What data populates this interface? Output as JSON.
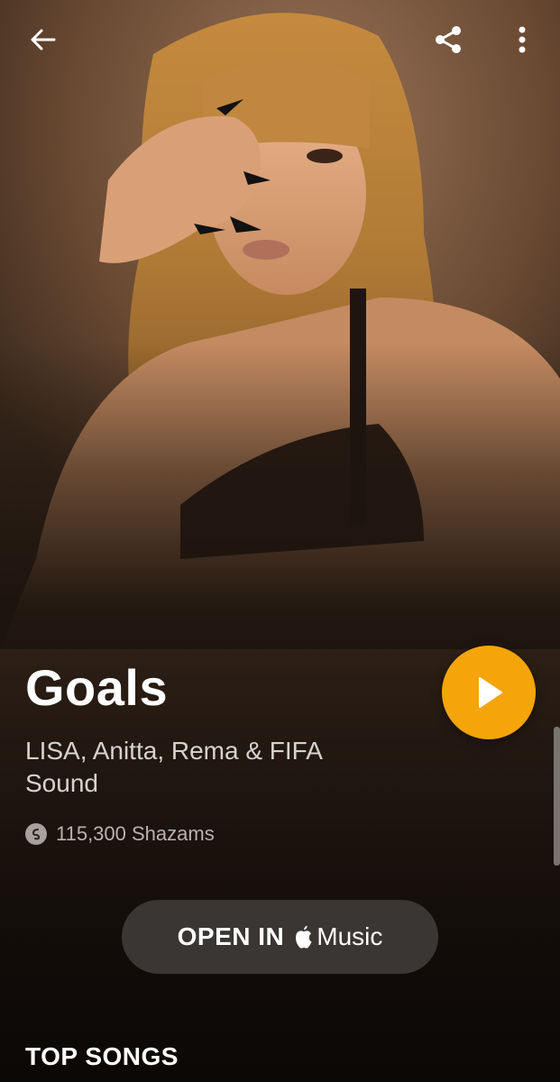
{
  "topbar": {
    "back_icon": "arrow-left-icon",
    "share_icon": "share-icon",
    "more_icon": "more-vertical-icon"
  },
  "track": {
    "title": "Goals",
    "artist": "LISA, Anitta, Rema & FIFA Sound",
    "shazam_count": "115,300 Shazams"
  },
  "actions": {
    "play_icon": "play-icon",
    "open_in_label": "OPEN IN",
    "music_brand": "Music",
    "brand_icon": "apple-icon"
  },
  "sections": {
    "top_songs": "TOP SONGS"
  },
  "colors": {
    "accent": "#f5a50a",
    "button_bg": "#3a3633",
    "background": "#1c140e"
  }
}
